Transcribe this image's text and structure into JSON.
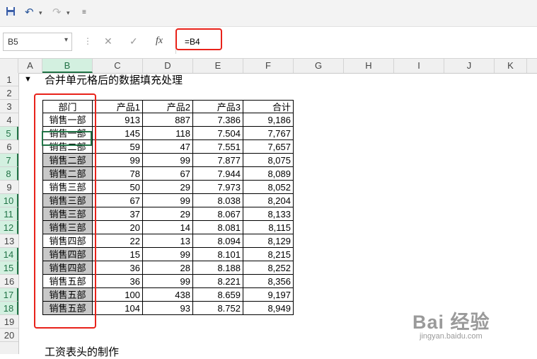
{
  "toolbar": {
    "save_icon": "save-icon",
    "undo_icon": "undo-icon",
    "redo_icon": "redo-icon",
    "customize_icon": "customize-quick-access-icon"
  },
  "formula_bar": {
    "name_box": "B5",
    "cancel_symbol": "✕",
    "enter_symbol": "✓",
    "fx_label": "fx",
    "formula": "=B4"
  },
  "columns": [
    "A",
    "B",
    "C",
    "D",
    "E",
    "F",
    "G",
    "H",
    "I",
    "J",
    "K"
  ],
  "rows": [
    "1",
    "2",
    "3",
    "4",
    "5",
    "6",
    "7",
    "8",
    "9",
    "10",
    "11",
    "12",
    "13",
    "14",
    "15",
    "16",
    "17",
    "18",
    "19",
    "20"
  ],
  "selected_column": "B",
  "selected_rows": [
    "5",
    "7",
    "8",
    "10",
    "11",
    "12",
    "14",
    "15",
    "17",
    "18"
  ],
  "sheet": {
    "title": "合并单元格后的数据填充处理",
    "bottom_text": "工资表头的制作",
    "headers": [
      "部门",
      "产品1",
      "产品2",
      "产品3",
      "合计"
    ],
    "table": [
      {
        "dept": "销售一部",
        "p1": "913",
        "p2": "887",
        "p3": "7.386",
        "total": "9,186",
        "gray": false
      },
      {
        "dept": "销售一部",
        "p1": "145",
        "p2": "118",
        "p3": "7.504",
        "total": "7,767",
        "gray": false
      },
      {
        "dept": "销售二部",
        "p1": "59",
        "p2": "47",
        "p3": "7.551",
        "total": "7,657",
        "gray": false
      },
      {
        "dept": "销售二部",
        "p1": "99",
        "p2": "99",
        "p3": "7.877",
        "total": "8,075",
        "gray": true
      },
      {
        "dept": "销售二部",
        "p1": "78",
        "p2": "67",
        "p3": "7.944",
        "total": "8,089",
        "gray": true
      },
      {
        "dept": "销售三部",
        "p1": "50",
        "p2": "29",
        "p3": "7.973",
        "total": "8,052",
        "gray": false
      },
      {
        "dept": "销售三部",
        "p1": "67",
        "p2": "99",
        "p3": "8.038",
        "total": "8,204",
        "gray": true
      },
      {
        "dept": "销售三部",
        "p1": "37",
        "p2": "29",
        "p3": "8.067",
        "total": "8,133",
        "gray": true
      },
      {
        "dept": "销售三部",
        "p1": "20",
        "p2": "14",
        "p3": "8.081",
        "total": "8,115",
        "gray": true
      },
      {
        "dept": "销售四部",
        "p1": "22",
        "p2": "13",
        "p3": "8.094",
        "total": "8,129",
        "gray": false
      },
      {
        "dept": "销售四部",
        "p1": "15",
        "p2": "99",
        "p3": "8.101",
        "total": "8,215",
        "gray": true
      },
      {
        "dept": "销售四部",
        "p1": "36",
        "p2": "28",
        "p3": "8.188",
        "total": "8,252",
        "gray": true
      },
      {
        "dept": "销售五部",
        "p1": "36",
        "p2": "99",
        "p3": "8.221",
        "total": "8,356",
        "gray": false
      },
      {
        "dept": "销售五部",
        "p1": "100",
        "p2": "438",
        "p3": "8.659",
        "total": "9,197",
        "gray": true
      },
      {
        "dept": "销售五部",
        "p1": "104",
        "p2": "93",
        "p3": "8.752",
        "total": "8,949",
        "gray": true
      }
    ]
  },
  "watermark": {
    "logo": "Bai 经验",
    "url": "jingyan.baidu.com"
  },
  "colors": {
    "accent_green": "#217346",
    "highlight_red": "#e8221a",
    "cell_gray": "#c8c8c8"
  }
}
